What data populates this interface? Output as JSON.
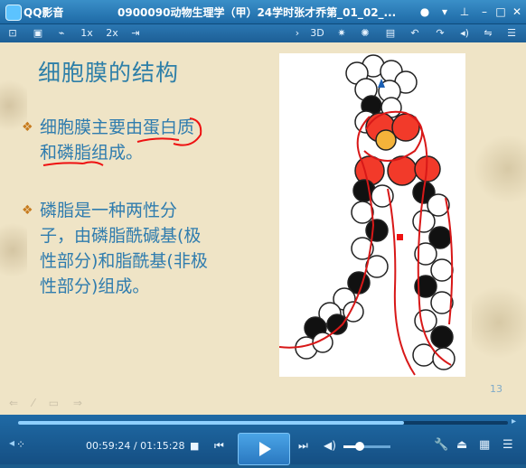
{
  "app": {
    "name": "QQ影音",
    "title": "0900090动物生理学（甲）24学时张才乔第_01_02_..."
  },
  "toolbar": {
    "speed1": "1x",
    "speed2": "2x",
    "mode3d": "3D"
  },
  "slide": {
    "title": "细胞膜的结构",
    "bullet1": "细胞膜主要由蛋白质和磷脂组成。",
    "bullet2": "磷脂是一种两性分子，由磷脂酰碱基(极性部分)和脂酰基(非极性部分)组成。",
    "page_number": "13"
  },
  "player": {
    "current_time": "00:59:24",
    "total_time": "01:15:28",
    "time_separator": " / ",
    "progress": 0.787,
    "volume": 0.35
  }
}
